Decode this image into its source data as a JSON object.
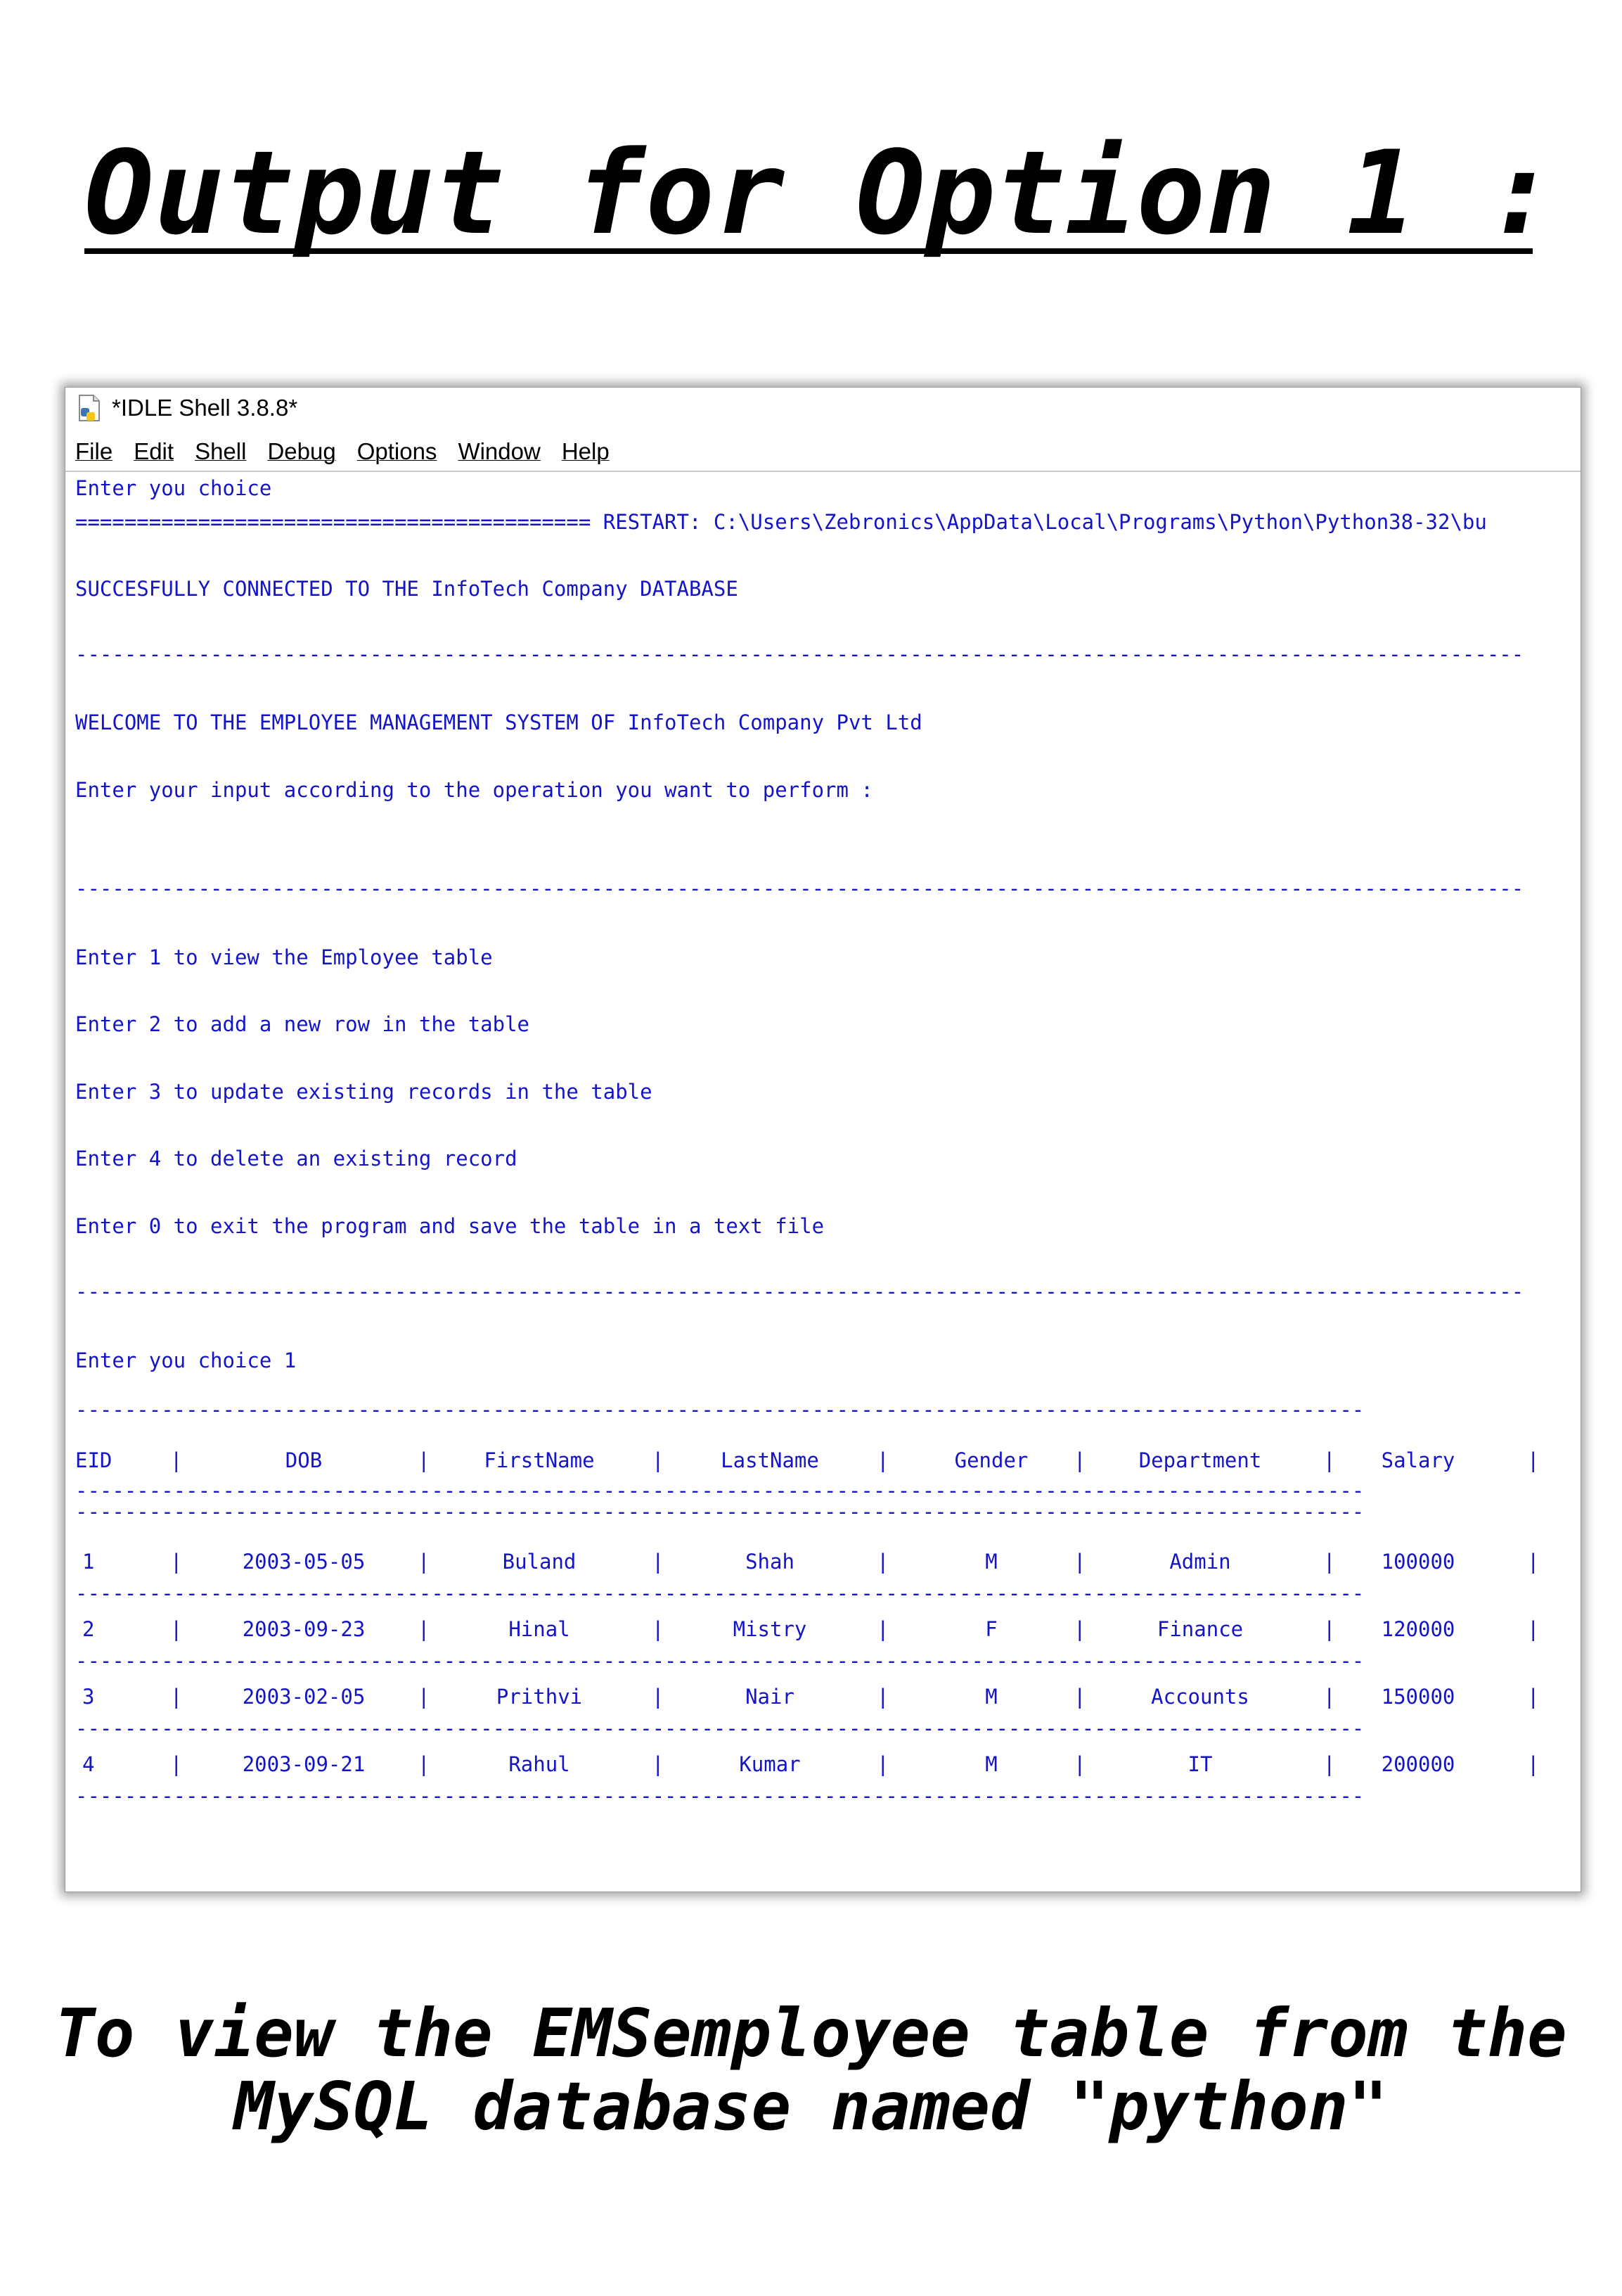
{
  "heading": "Output for Option 1 :",
  "window": {
    "title": "*IDLE Shell 3.8.8*",
    "menu": [
      "File",
      "Edit",
      "Shell",
      "Debug",
      "Options",
      "Window",
      "Help"
    ]
  },
  "console": {
    "line1": "Enter you choice",
    "restart": "========================================== RESTART: C:\\Users\\Zebronics\\AppData\\Local\\Programs\\Python\\Python38-32\\bu",
    "connected": "SUCCESFULLY CONNECTED TO THE InfoTech Company DATABASE",
    "dashes": "----------------------------------------------------------------------------------------------------------------------",
    "welcome": "WELCOME TO THE EMPLOYEE MANAGEMENT SYSTEM OF InfoTech Company Pvt Ltd",
    "prompt": "Enter your input according to the operation you want to perform :",
    "options": [
      "Enter 1 to view the Employee table",
      "Enter 2 to add a new row in the table",
      "Enter 3 to update existing records in the table",
      "Enter 4 to delete an existing record",
      "Enter 0 to exit the program and save the table in a text file"
    ],
    "choice": "Enter you choice 1",
    "separator": "|"
  },
  "table": {
    "columns": [
      "EID",
      "DOB",
      "FirstName",
      "LastName",
      "Gender",
      "Department",
      "Salary"
    ],
    "rows": [
      [
        "1",
        "2003-05-05",
        "Buland",
        "Shah",
        "M",
        "Admin",
        "100000"
      ],
      [
        "2",
        "2003-09-23",
        "Hinal",
        "Mistry",
        "F",
        "Finance",
        "120000"
      ],
      [
        "3",
        "2003-02-05",
        "Prithvi",
        "Nair",
        "M",
        "Accounts",
        "150000"
      ],
      [
        "4",
        "2003-09-21",
        "Rahul",
        "Kumar",
        "M",
        "IT",
        "200000"
      ]
    ]
  },
  "caption": {
    "line1": "To view the EMSemployee table from the",
    "line2": "MySQL database named \"python\""
  },
  "colors": {
    "console_text": "#1515c8",
    "background": "#ffffff"
  }
}
